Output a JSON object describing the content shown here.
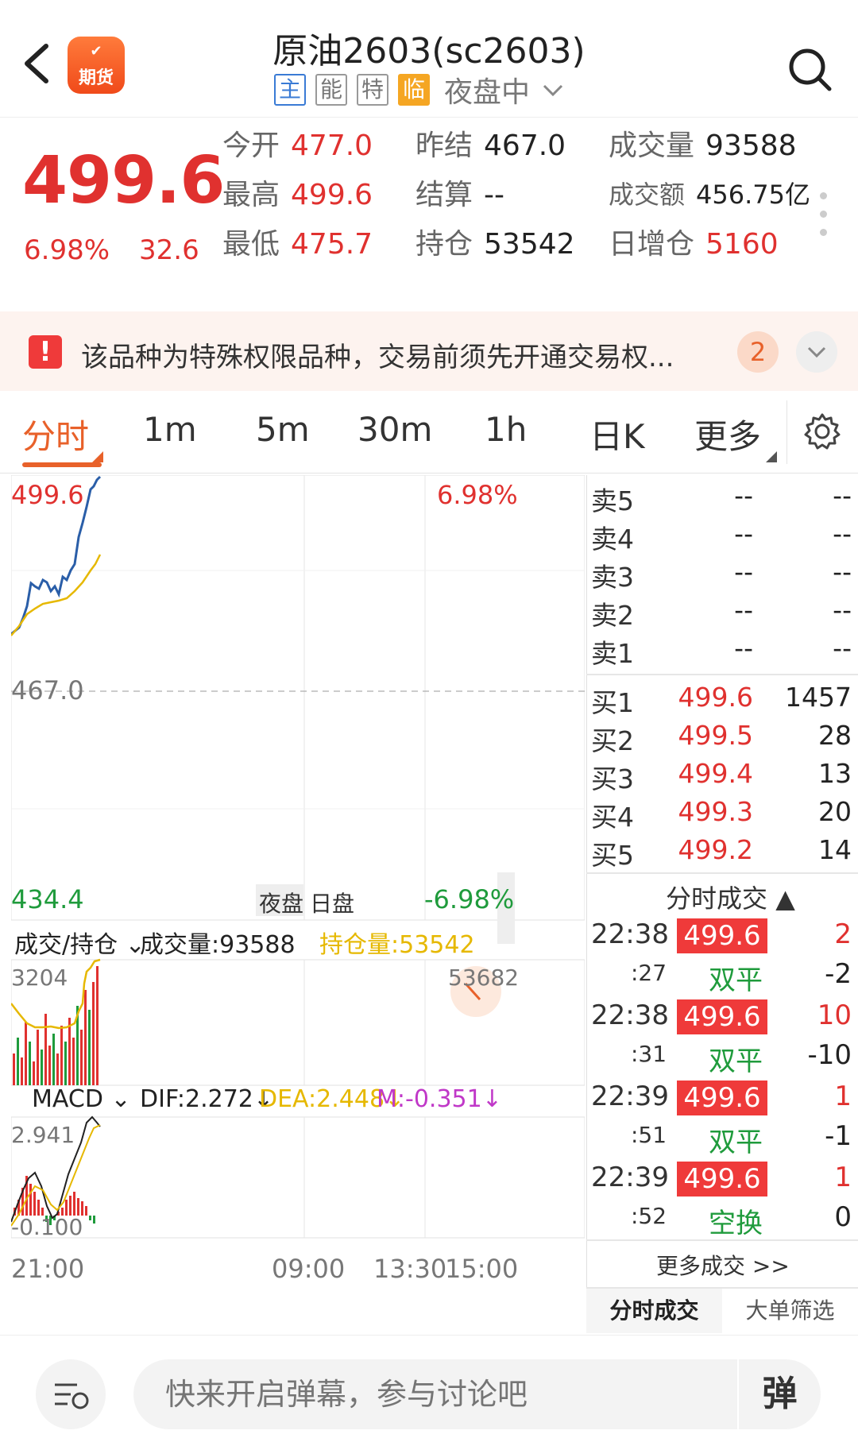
{
  "header": {
    "title": "原油2603(sc2603)",
    "logo_text_top": "✔",
    "logo_text": "期货",
    "tags": [
      "主",
      "能",
      "特",
      "临"
    ],
    "session": "夜盘中"
  },
  "quote": {
    "last_price": "499.6",
    "change_pct": "6.98%",
    "change_val": "32.6",
    "fields": {
      "open_k": "今开",
      "open_v": "477.0",
      "high_k": "最高",
      "high_v": "499.6",
      "low_k": "最低",
      "low_v": "475.7",
      "prev_settle_k": "昨结",
      "prev_settle_v": "467.0",
      "settle_k": "结算",
      "settle_v": "--",
      "oi_k": "持仓",
      "oi_v": "53542",
      "volume_k": "成交量",
      "volume_v": "93588",
      "turnover_k": "成交额",
      "turnover_v": "456.75亿",
      "oi_change_k": "日增仓",
      "oi_change_v": "5160"
    }
  },
  "notice": {
    "icon": "!",
    "text": "该品种为特殊权限品种，交易前须先开通交易权...",
    "count": "2"
  },
  "tabs": [
    "分时",
    "1m",
    "5m",
    "30m",
    "1h",
    "日K",
    "更多"
  ],
  "chart": {
    "price_top": "499.6",
    "pct_top": "6.98%",
    "prev_close": "467.0",
    "price_bottom": "434.4",
    "pct_bottom": "-6.98%",
    "session_night": "夜盘",
    "session_day": "日盘",
    "sub_selector": "成交/持仓",
    "volume_label": "成交量:93588",
    "oi_label": "持仓量:53542",
    "vol_max": "3204",
    "oi_max": "53682",
    "macd_selector": "MACD",
    "dif": "DIF:2.272↓",
    "dea": "DEA:2.448↓",
    "m": "M:-0.351↓",
    "macd_max": "2.941",
    "macd_min": "-0.100",
    "time_labels": [
      "21:00",
      "09:00",
      "13:30",
      "15:00"
    ],
    "colors": {
      "price_line": "#2a5ea8",
      "avg_line": "#e6b800",
      "up": "#e0312f",
      "down": "#1f9b3c"
    }
  },
  "order_book": {
    "asks": [
      {
        "label": "卖5",
        "price": "--",
        "qty": "--"
      },
      {
        "label": "卖4",
        "price": "--",
        "qty": "--"
      },
      {
        "label": "卖3",
        "price": "--",
        "qty": "--"
      },
      {
        "label": "卖2",
        "price": "--",
        "qty": "--"
      },
      {
        "label": "卖1",
        "price": "--",
        "qty": "--"
      }
    ],
    "bids": [
      {
        "label": "买1",
        "price": "499.6",
        "qty": "1457"
      },
      {
        "label": "买2",
        "price": "499.5",
        "qty": "28"
      },
      {
        "label": "买3",
        "price": "499.4",
        "qty": "13"
      },
      {
        "label": "买4",
        "price": "499.3",
        "qty": "20"
      },
      {
        "label": "买5",
        "price": "499.2",
        "qty": "14"
      }
    ]
  },
  "trades": {
    "title": "分时成交",
    "rows": [
      {
        "time": "22:38",
        "sec": ":27",
        "price": "499.6",
        "qty": "2",
        "type": "双平",
        "oi": "-2"
      },
      {
        "time": "22:38",
        "sec": ":31",
        "price": "499.6",
        "qty": "10",
        "type": "双平",
        "oi": "-10"
      },
      {
        "time": "22:39",
        "sec": ":51",
        "price": "499.6",
        "qty": "1",
        "type": "双平",
        "oi": "-1"
      },
      {
        "time": "22:39",
        "sec": ":52",
        "price": "499.6",
        "qty": "1",
        "type": "空换",
        "oi": "0"
      }
    ],
    "more": "更多成交 >>",
    "tab_active": "分时成交",
    "tab_other": "大单筛选"
  },
  "bottom": {
    "placeholder": "快来开启弹幕，参与讨论吧",
    "toggle": "弹"
  }
}
